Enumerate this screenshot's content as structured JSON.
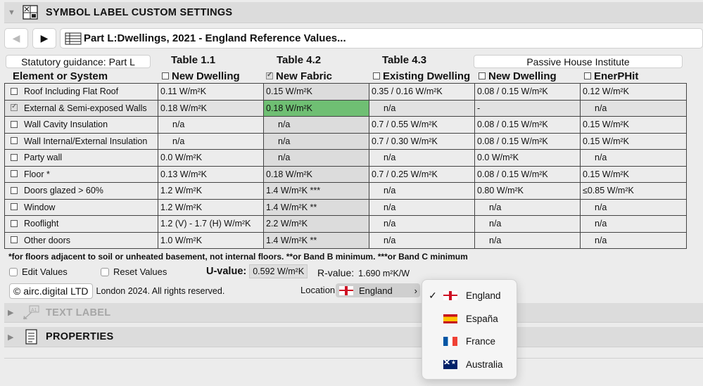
{
  "panel": {
    "title": "SYMBOL LABEL CUSTOM SETTINGS"
  },
  "nav": {
    "path": "Part L:Dwellings, 2021 - England Reference Values..."
  },
  "groups": {
    "statutory": "Statutory guidance: Part L",
    "passive": "Passive House Institute"
  },
  "tables": {
    "t11": "Table 1.1",
    "t42": "Table 4.2",
    "t43": "Table 4.3"
  },
  "columns": {
    "element": "Element or System",
    "new_dwelling": "New Dwelling",
    "new_fabric": "New Fabric",
    "existing_dwelling": "Existing Dwelling",
    "ph_new_dwelling": "New Dwelling",
    "enerphit": "EnerPHit"
  },
  "rows": [
    {
      "name": "Roof Including Flat Roof",
      "checked": false,
      "v": [
        "0.11 W/m²K",
        "0.15 W/m²K",
        "0.35 / 0.16 W/m²K",
        "0.08 / 0.15 W/m²K",
        "0.12 W/m²K"
      ]
    },
    {
      "name": "External & Semi-exposed Walls",
      "checked": true,
      "v": [
        "0.18 W/m²K",
        "0.18 W/m²K",
        "n/a",
        "-",
        "n/a"
      ]
    },
    {
      "name": "Wall Cavity Insulation",
      "checked": false,
      "v": [
        "n/a",
        "n/a",
        "0.7 / 0.55 W/m²K",
        "0.08 / 0.15 W/m²K",
        "0.15 W/m²K"
      ]
    },
    {
      "name": "Wall Internal/External Insulation",
      "checked": false,
      "v": [
        "n/a",
        "n/a",
        "0.7 / 0.30 W/m²K",
        "0.08 / 0.15 W/m²K",
        "0.15 W/m²K"
      ]
    },
    {
      "name": "Party wall",
      "checked": false,
      "v": [
        "0.0 W/m²K",
        "n/a",
        "n/a",
        "0.0 W/m²K",
        "n/a"
      ]
    },
    {
      "name": "Floor *",
      "checked": false,
      "v": [
        "0.13 W/m²K",
        "0.18 W/m²K",
        "0.7 / 0.25 W/m²K",
        "0.08 / 0.15 W/m²K",
        "0.15 W/m²K"
      ]
    },
    {
      "name": "Doors glazed > 60%",
      "checked": false,
      "v": [
        "1.2 W/m²K",
        "1.4 W/m²K ***",
        "n/a",
        "0.80 W/m²K",
        "≤0.85 W/m²K"
      ]
    },
    {
      "name": "Window",
      "checked": false,
      "v": [
        "1.2 W/m²K",
        "1.4 W/m²K **",
        "n/a",
        "n/a",
        "n/a"
      ]
    },
    {
      "name": "Rooflight",
      "checked": false,
      "v": [
        "1.2 (V) - 1.7 (H) W/m²K",
        "2.2 W/m²K",
        "n/a",
        "n/a",
        "n/a"
      ]
    },
    {
      "name": "Other doors",
      "checked": false,
      "v": [
        "1.0 W/m²K",
        "1.4 W/m²K **",
        "n/a",
        "n/a",
        "n/a"
      ]
    }
  ],
  "footnote": "*for floors adjacent to soil or unheated basement, not internal floors.  **or Band B minimum.  ***or Band C minimum",
  "options": {
    "edit": "Edit Values",
    "reset": "Reset Values"
  },
  "u_value": {
    "label": "U-value:",
    "value": "0.592 W/m²K"
  },
  "r_value": {
    "label": "R-value:",
    "value": "1.690 m²K/W"
  },
  "copyright": {
    "badge": "© airc.digital LTD",
    "text": "London 2024. All rights reserved."
  },
  "location": {
    "label": "Location",
    "selected": "England"
  },
  "location_menu": [
    {
      "label": "England",
      "flag": "england-flag-icon",
      "checked": true
    },
    {
      "label": "España",
      "flag": "spain-flag-icon",
      "checked": false
    },
    {
      "label": "France",
      "flag": "france-flag-icon",
      "checked": false
    },
    {
      "label": "Australia",
      "flag": "australia-flag-icon",
      "checked": false
    }
  ],
  "sections": {
    "text_label": "TEXT LABEL",
    "properties": "PROPERTIES"
  },
  "colors": {
    "highlight": "#6fbf73",
    "header_bg": "#dcdcdc"
  }
}
